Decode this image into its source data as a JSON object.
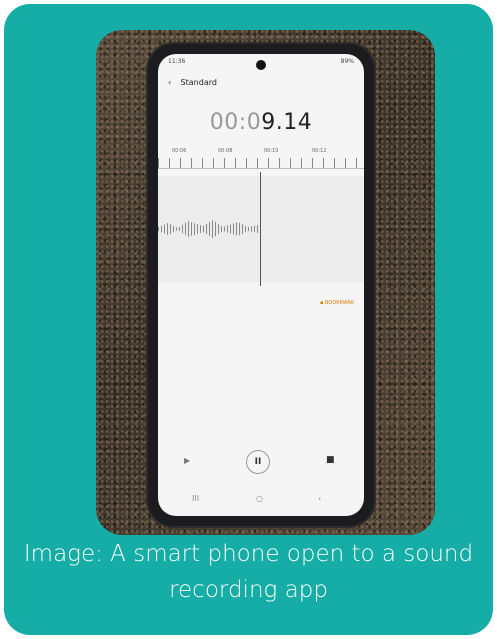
{
  "colors": {
    "card_background": "#15ada5",
    "caption_text": "#ffffff"
  },
  "screen": {
    "status_time": "11:36",
    "status_right": "89%",
    "title": "Standard",
    "timer_dim": "00:0",
    "timer_main": "9.14",
    "ruler_labels": [
      "00:06",
      "00:08",
      "00:10",
      "00:12"
    ],
    "bookmark": "BOOKMARK",
    "play_icon": "play-icon",
    "pause_icon": "pause-icon",
    "stop_icon": "stop-icon"
  },
  "caption": "Image: A smart phone open to a sound recording app"
}
